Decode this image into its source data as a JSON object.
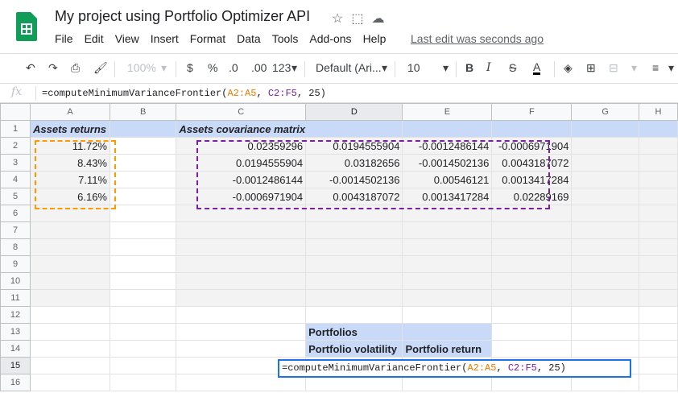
{
  "app": {
    "title": "My project using Portfolio Optimizer API",
    "menu": [
      "File",
      "Edit",
      "View",
      "Insert",
      "Format",
      "Data",
      "Tools",
      "Add-ons",
      "Help"
    ],
    "last_edit": "Last edit was seconds ago"
  },
  "toolbar": {
    "zoom": "100%",
    "currency": "$",
    "percent": "%",
    "dec_less": ".0",
    "dec_more": ".00",
    "format_more": "123",
    "font": "Default (Ari...",
    "font_size": "10",
    "bold": "B",
    "italic": "I",
    "strike": "S",
    "text_color": "A"
  },
  "formula_bar": {
    "fx": "fx",
    "prefix": "=computeMinimumVarianceFrontier(",
    "ref1": "A2:A5",
    "sep1": ", ",
    "ref2": "C2:F5",
    "tail": ", 25)"
  },
  "columns": [
    "A",
    "B",
    "C",
    "D",
    "E",
    "F",
    "G",
    "H"
  ],
  "rows": [
    "1",
    "2",
    "3",
    "4",
    "5",
    "6",
    "7",
    "8",
    "9",
    "10",
    "11",
    "12",
    "13",
    "14",
    "15",
    "16"
  ],
  "cells": {
    "A1": "Assets returns",
    "C1": "Assets covariance matrix",
    "A2": "11.72%",
    "A3": "8.43%",
    "A4": "7.11%",
    "A5": "6.16%",
    "C2": "0.02359296",
    "D2": "0.0194555904",
    "E2": "-0.0012486144",
    "F2": "-0.0006971904",
    "C3": "0.0194555904",
    "D3": "0.03182656",
    "E3": "-0.0014502136",
    "F3": "0.0043187072",
    "C4": "-0.0012486144",
    "D4": "-0.0014502136",
    "E4": "0.00546121",
    "F4": "0.0013417284",
    "C5": "-0.0006971904",
    "D5": "0.0043187072",
    "E5": "0.0013417284",
    "F5": "0.02289169",
    "D13": "Portfolios",
    "D14": "Portfolio volatility",
    "E14": "Portfolio return",
    "D15_prefix": "=computeMinimumVarianceFrontier(",
    "D15_ref1": "A2:A5",
    "D15_sep": ", ",
    "D15_ref2": "C2:F5",
    "D15_tail": ", 25)"
  }
}
